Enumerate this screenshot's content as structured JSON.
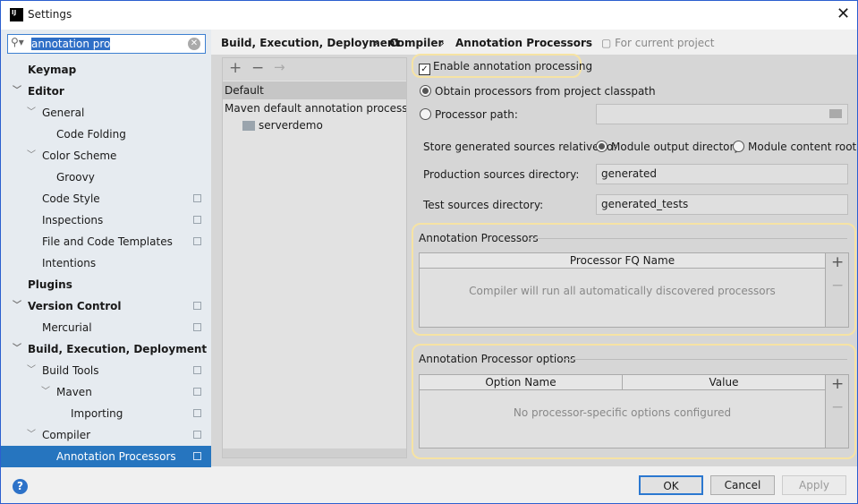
{
  "window": {
    "title": "Settings",
    "app_icon": "IJ"
  },
  "search": {
    "value": "annotation pro"
  },
  "sidebar": {
    "items": [
      {
        "label": "Keymap",
        "bold": true,
        "level": 0,
        "chevron": false,
        "copy": false
      },
      {
        "label": "Editor",
        "bold": true,
        "level": 0,
        "chevron": true,
        "copy": false
      },
      {
        "label": "General",
        "level": 1,
        "chevron": true,
        "copy": false
      },
      {
        "label": "Code Folding",
        "level": 2,
        "chevron": false,
        "copy": false
      },
      {
        "label": "Color Scheme",
        "level": 1,
        "chevron": true,
        "copy": false
      },
      {
        "label": "Groovy",
        "level": 2,
        "chevron": false,
        "copy": false
      },
      {
        "label": "Code Style",
        "level": 1,
        "chevron": false,
        "copy": true
      },
      {
        "label": "Inspections",
        "level": 1,
        "chevron": false,
        "copy": true
      },
      {
        "label": "File and Code Templates",
        "level": 1,
        "chevron": false,
        "copy": true
      },
      {
        "label": "Intentions",
        "level": 1,
        "chevron": false,
        "copy": false
      },
      {
        "label": "Plugins",
        "bold": true,
        "level": 0,
        "chevron": false,
        "copy": false
      },
      {
        "label": "Version Control",
        "bold": true,
        "level": 0,
        "chevron": true,
        "copy": true
      },
      {
        "label": "Mercurial",
        "level": 1,
        "chevron": false,
        "copy": true
      },
      {
        "label": "Build, Execution, Deployment",
        "bold": true,
        "level": 0,
        "chevron": true,
        "copy": false
      },
      {
        "label": "Build Tools",
        "level": 1,
        "chevron": true,
        "copy": true
      },
      {
        "label": "Maven",
        "level": 2,
        "chevron": true,
        "copy": true
      },
      {
        "label": "Importing",
        "level": 3,
        "chevron": false,
        "copy": true
      },
      {
        "label": "Compiler",
        "level": 1,
        "chevron": true,
        "copy": true
      },
      {
        "label": "Annotation Processors",
        "level": 2,
        "chevron": false,
        "copy": true,
        "selected": true
      }
    ]
  },
  "breadcrumb": {
    "items": [
      "Build, Execution, Deployment",
      "Compiler",
      "Annotation Processors"
    ],
    "scope": "For current project"
  },
  "profiles": {
    "items": [
      "Default",
      "Maven default annotation processors p"
    ],
    "module": "serverdemo"
  },
  "settings": {
    "enable_label": "Enable annotation processing",
    "enabled": true,
    "obtain_label": "Obtain processors from project classpath",
    "path_label": "Processor path:",
    "store_label": "Store generated sources relative to:",
    "module_output": "Module output directory",
    "module_content": "Module content root",
    "prod_label": "Production sources directory:",
    "prod_value": "generated",
    "test_label": "Test sources directory:",
    "test_value": "generated_tests"
  },
  "processors": {
    "title": "Annotation Processors",
    "column": "Processor FQ Name",
    "empty": "Compiler will run all automatically discovered processors"
  },
  "options": {
    "title": "Annotation Processor options",
    "columns": [
      "Option Name",
      "Value"
    ],
    "empty": "No processor-specific options configured"
  },
  "buttons": {
    "ok": "OK",
    "cancel": "Cancel",
    "apply": "Apply"
  },
  "colors": {
    "selection": "#2675bf",
    "highlight": "#f6e3a4"
  }
}
